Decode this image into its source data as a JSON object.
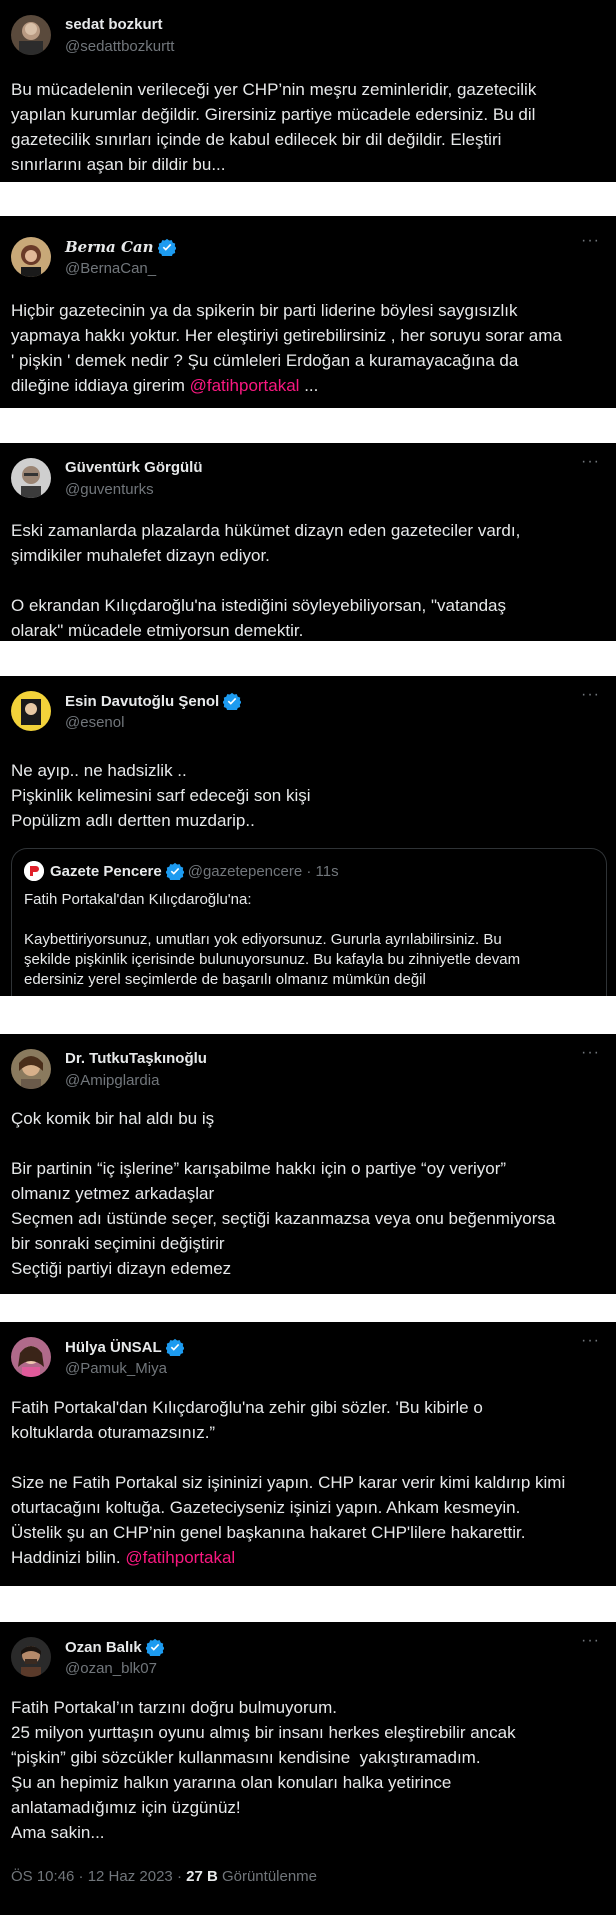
{
  "tweets": [
    {
      "name": "sedat bozkurt",
      "handle": "@sedattbozkurtt",
      "text": "Bu mücadelenin verileceği yer CHP’nin meşru zeminleridir, gazetecilik\nyapılan kurumlar değildir. Girersiniz partiye mücadele edersiniz. Bu dil\ngazetecilik sınırları içinde de kabul edilecek bir dil değildir. Eleştiri\nsınırlarını aşan bir dildir bu..."
    },
    {
      "name": "Berna Can",
      "handle": "@BernaCan_",
      "more": "···",
      "text": "Hiçbir gazetecinin ya da spikerin bir parti liderine böylesi saygısızlık\nyapmaya hakkı yoktur. Her eleştiriyi getirebilirsiniz , her soruyu sorar ama\n' pişkin ' demek nedir ? Şu cümleleri Erdoğan a kuramayacağına da\ndileğine iddiaya girerim ",
      "mention": "@fatihportakal",
      "suffix": " ..."
    },
    {
      "name": "Güventürk Görgülü",
      "handle": "@guventurks",
      "more": "···",
      "text": "Eski zamanlarda plazalarda hükümet dizayn eden gazeteciler vardı,\nşimdikiler muhalefet dizayn ediyor.\n\nO ekrandan Kılıçdaroğlu'na istediğini söyleyebiliyorsan, \"vatandaş\nolarak\" mücadele etmiyorsun demektir."
    },
    {
      "name": "Esin Davutoğlu Şenol",
      "handle": "@esenol",
      "more": "···",
      "text": "Ne ayıp.. ne hadsizlik ..\nPişkinlik kelimesini sarf edeceği son kişi\nPopülizm adlı dertten muzdarip..",
      "quote": {
        "name": "Gazete Pencere",
        "handle": "@gazetepencere · 11s",
        "text": "Fatih Portakal'dan Kılıçdaroğlu'na:\n\nKaybettiriyorsunuz, umutları yok ediyorsunuz. Gururla ayrılabilirsiniz. Bu\nşekilde pişkinlik içerisinde bulunuyorsunuz. Bu kafayla bu zihniyetle devam\nedersiniz yerel seçimlerde de başarılı olmanız mümkün değil"
      }
    },
    {
      "name": "Dr. TutkuTaşkınoğlu",
      "handle": "@Amipglardia",
      "more": "···",
      "text": "Çok komik bir hal aldı bu iş\n\nBir partinin “iç işlerine” karışabilme hakkı için o partiye “oy veriyor”\nolmanız yetmez arkadaşlar\nSeçmen adı üstünde seçer, seçtiği kazanmazsa veya onu beğenmiyorsa\nbir sonraki seçimini değiştirir\nSeçtiği partiyi dizayn edemez"
    },
    {
      "name": "Hülya ÜNSAL",
      "handle": "@Pamuk_Miya",
      "more": "···",
      "text": "Fatih Portakal'dan Kılıçdaroğlu'na zehir gibi sözler. 'Bu kibirle o\nkoltuklarda oturamazsınız.”\n\nSize ne Fatih Portakal siz işininizi yapın. CHP karar verir kimi kaldırıp kimi\noturtacağını koltuğa. Gazeteciyseniz işinizi yapın. Ahkam kesmeyin.\nÜstelik şu an CHP’nin genel başkanına hakaret CHP'lilere hakarettir.\nHaddinizi bilin. ",
      "mention": "@fatihportakal"
    },
    {
      "name": "Ozan Balık",
      "handle": "@ozan_blk07",
      "more": "···",
      "text": "Fatih Portakal’ın tarzını doğru bulmuyorum.\n25 milyon yurttaşın oyunu almış bir insanı herkes eleştirebilir ancak\n“pişkin” gibi sözcükler kullanmasını kendisine  yakıştıramadım.\nŞu an hepimiz halkın yararına olan konuları halka yetirince\nanlatamadığımız için üzgünüz!\nAma sakin...",
      "meta_time": "ÖS 10:46 · 12 Haz 2023 · ",
      "meta_views_count": "27 B",
      "meta_views_label": " Görüntülenme"
    }
  ],
  "colors": {
    "background": "#000000",
    "text": "#e7e9ea",
    "secondary": "#71767b",
    "mention": "#f91880",
    "verified": "#1d9bf0"
  }
}
